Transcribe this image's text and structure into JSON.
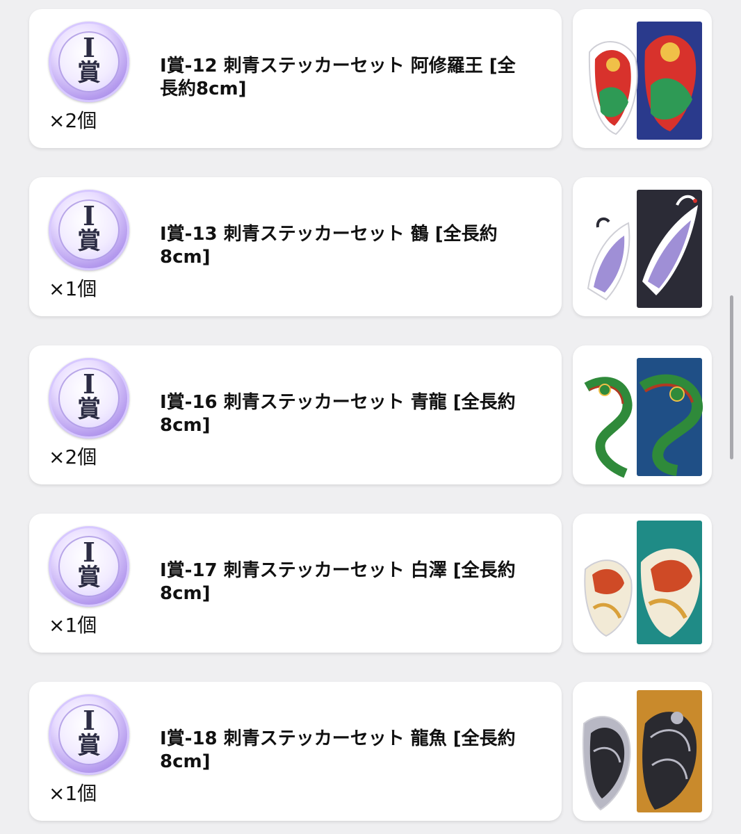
{
  "prize_list": {
    "items": [
      {
        "badge_letter": "I",
        "badge_kanji": "賞",
        "title": "I賞-12 刺青ステッカーセット 阿修羅王 [全長約8cm]",
        "quantity": "×2個",
        "image_theme": "ashura-king",
        "colors": {
          "bg": "#2a3a8c",
          "accent": "#d8322c",
          "secondary": "#2e9a55"
        }
      },
      {
        "badge_letter": "I",
        "badge_kanji": "賞",
        "title": "I賞-13 刺青ステッカーセット 鶴 [全長約8cm]",
        "quantity": "×1個",
        "image_theme": "crane",
        "colors": {
          "bg": "#2b2b36",
          "accent": "#ffffff",
          "secondary": "#9f8fd6"
        }
      },
      {
        "badge_letter": "I",
        "badge_kanji": "賞",
        "title": "I賞-16 刺青ステッカーセット 青龍 [全長約8cm]",
        "quantity": "×2個",
        "image_theme": "blue-dragon",
        "colors": {
          "bg": "#1f4f86",
          "accent": "#2f8a3a",
          "secondary": "#b03a22"
        }
      },
      {
        "badge_letter": "I",
        "badge_kanji": "賞",
        "title": "I賞-17 刺青ステッカーセット 白澤 [全長約8cm]",
        "quantity": "×1個",
        "image_theme": "baize",
        "colors": {
          "bg": "#1f8b86",
          "accent": "#f2ead6",
          "secondary": "#cf4a26"
        }
      },
      {
        "badge_letter": "I",
        "badge_kanji": "賞",
        "title": "I賞-18 刺青ステッカーセット 龍魚 [全長約8cm]",
        "quantity": "×1個",
        "image_theme": "dragon-fish",
        "colors": {
          "bg": "#c98a2c",
          "accent": "#2a2a30",
          "secondary": "#b8b8c4"
        }
      }
    ]
  }
}
